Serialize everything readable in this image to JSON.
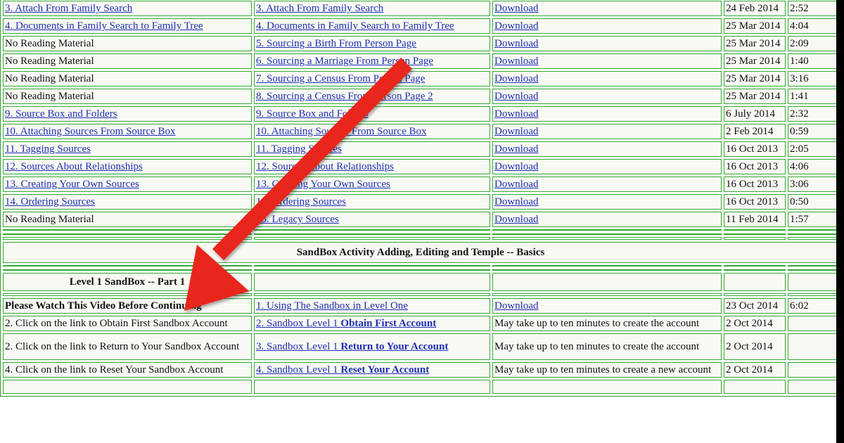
{
  "rows": [
    {
      "c1": "3. Attach From Family Search",
      "c1_link": true,
      "c2": "3. Attach From Family Search",
      "c3": "Download",
      "date": "24 Feb 2014",
      "time": "2:52"
    },
    {
      "c1": "4. Documents in Family Search to Family Tree",
      "c1_link": true,
      "c2": "4. Documents in Family Search to Family Tree",
      "c3": "Download",
      "date": "25 Mar 2014",
      "time": "4:04"
    },
    {
      "c1": "No Reading Material",
      "c1_link": false,
      "c2": "5. Sourcing a Birth From Person Page",
      "c3": "Download",
      "date": "25 Mar 2014",
      "time": "2:09"
    },
    {
      "c1": "No Reading Material",
      "c1_link": false,
      "c2": "6. Sourcing a Marriage From Person Page",
      "c3": "Download",
      "date": "25 Mar 2014",
      "time": "1:40"
    },
    {
      "c1": "No Reading Material",
      "c1_link": false,
      "c2": "7. Sourcing a Census From Person Page",
      "c3": "Download",
      "date": "25 Mar 2014",
      "time": "3:16"
    },
    {
      "c1": "No Reading Material",
      "c1_link": false,
      "c2": "8. Sourcing a Census From Person Page 2",
      "c3": "Download",
      "date": "25 Mar 2014",
      "time": "1:41"
    },
    {
      "c1": "9. Source Box and Folders",
      "c1_link": true,
      "c2": "9. Source Box and Folders",
      "c3": "Download",
      "date": "6 July 2014",
      "time": "2:32"
    },
    {
      "c1": "10. Attaching Sources From Source Box",
      "c1_link": true,
      "c2": "10. Attaching Sources From Source Box",
      "c3": "Download",
      "date": "2 Feb 2014",
      "time": "0:59"
    },
    {
      "c1": "11. Tagging Sources",
      "c1_link": true,
      "c2": "11. Tagging Sources",
      "c3": "Download",
      "date": "16 Oct 2013",
      "time": "2:05"
    },
    {
      "c1": "12. Sources About Relationships",
      "c1_link": true,
      "c2": "12. Sources About Relationships",
      "c3": "Download",
      "date": "16 Oct 2013",
      "time": "4:06"
    },
    {
      "c1": "13. Creating Your Own Sources",
      "c1_link": true,
      "c2": "13. Creating Your Own Sources",
      "c3": "Download",
      "date": "16 Oct 2013",
      "time": "3:06"
    },
    {
      "c1": "14. Ordering Sources",
      "c1_link": true,
      "c2": "14. Ordering Sources",
      "c3": "Download",
      "date": "16 Oct 2013",
      "time": "0:50"
    },
    {
      "c1": "No Reading Material",
      "c1_link": false,
      "c2": "15. Legacy Sources",
      "c3": "Download",
      "date": "11 Feb 2014",
      "time": "1:57"
    }
  ],
  "section_title": "SandBox Activity Adding, Editing and Temple -- Basics",
  "level_title": "Level 1 SandBox -- Part 1",
  "sandbox_rows": [
    {
      "c1": "Please Watch This Video Before Continuing",
      "c2_plain": "1. Using The Sandbox in Level One",
      "c2_bold": "",
      "c3": "Download",
      "c3_link": true,
      "date": "23 Oct 2014",
      "time": "6:02"
    },
    {
      "c1": "2. Click on the link to Obtain First Sandbox Account",
      "c2_plain": "2. Sandbox Level 1 ",
      "c2_bold": "Obtain First Account",
      "c3": "May take up to ten minutes to create the account",
      "c3_link": false,
      "date": "2 Oct 2014",
      "time": ""
    },
    {
      "c1": "2. Click on the link to Return to Your Sandbox Account",
      "c2_plain": "3. Sandbox Level 1 ",
      "c2_bold": "Return to Your Account",
      "c3": "May take up to ten minutes to create the account",
      "c3_link": false,
      "date": "2 Oct 2014",
      "time": ""
    },
    {
      "c1": "4. Click on the link to Reset Your Sandbox Account",
      "c2_plain": "4. Sandbox Level 1 ",
      "c2_bold": "Reset Your Account",
      "c3": "May take up to ten minutes to create a new account",
      "c3_link": false,
      "date": "2 Oct 2014",
      "time": ""
    }
  ],
  "colors": {
    "link": "#1f2fb3",
    "border": "#35a835",
    "level_bg": "#c6f0d4",
    "arrow": "#e8261c"
  }
}
